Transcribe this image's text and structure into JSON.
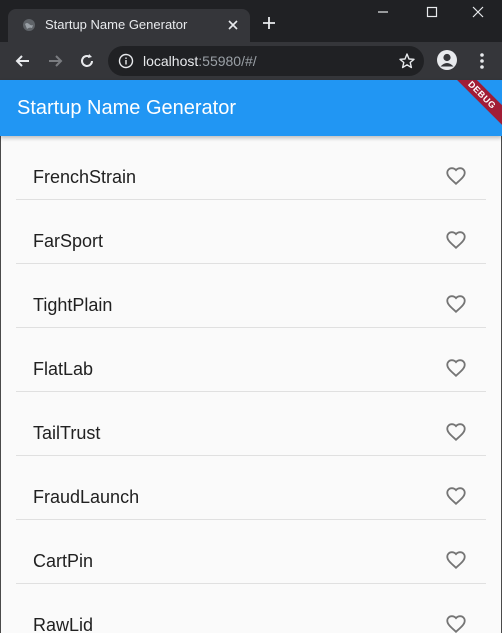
{
  "browser": {
    "tab_title": "Startup Name Generator",
    "url_host": "localhost",
    "url_path": ":55980/#/"
  },
  "app": {
    "title": "Startup Name Generator",
    "debug_banner": "DEBUG",
    "colors": {
      "appbar": "#2196f3",
      "debug": "#a11d36",
      "heart": "#757575"
    }
  },
  "names": [
    {
      "label": "FrenchStrain",
      "saved": false
    },
    {
      "label": "FarSport",
      "saved": false
    },
    {
      "label": "TightPlain",
      "saved": false
    },
    {
      "label": "FlatLab",
      "saved": false
    },
    {
      "label": "TailTrust",
      "saved": false
    },
    {
      "label": "FraudLaunch",
      "saved": false
    },
    {
      "label": "CartPin",
      "saved": false
    },
    {
      "label": "RawLid",
      "saved": false
    }
  ]
}
